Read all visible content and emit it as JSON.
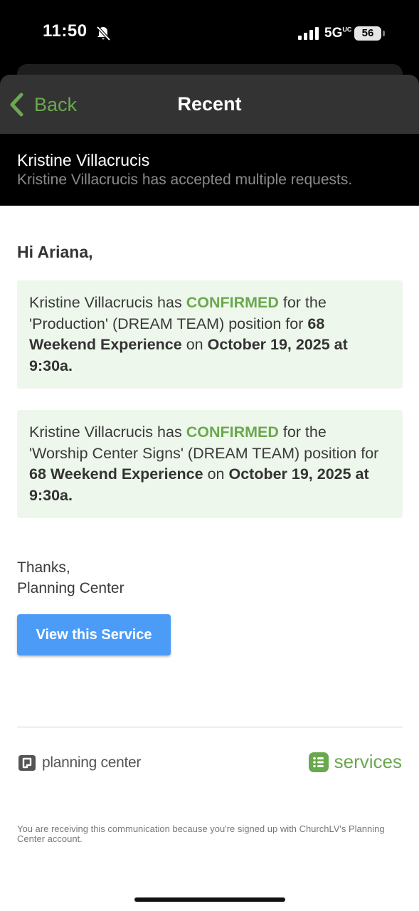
{
  "status_bar": {
    "time": "11:50",
    "network": "5G",
    "network_superscript": "UC",
    "battery": "56"
  },
  "nav": {
    "back_label": "Back",
    "title": "Recent"
  },
  "sender": {
    "name": "Kristine Villacrucis",
    "summary": "Kristine Villacrucis has accepted multiple requests."
  },
  "email": {
    "greeting": "Hi Ariana,",
    "notices": [
      {
        "person": "Kristine Villacrucis",
        "pre": " has ",
        "status": "CONFIRMED",
        "mid": " for the 'Production' (DREAM TEAM) position for ",
        "event": "68 Weekend Experience",
        "on": " on ",
        "datetime": "October 19, 2025 at 9:30a."
      },
      {
        "person": "Kristine Villacrucis",
        "pre": " has ",
        "status": "CONFIRMED",
        "mid": " for the 'Worship Center Signs' (DREAM TEAM) position for ",
        "event": "68 Weekend Experience",
        "on": " on ",
        "datetime": "October 19, 2025 at 9:30a."
      }
    ],
    "thanks": "Thanks,",
    "signature": "Planning Center",
    "view_button": "View this Service",
    "footer_brand": "planning center",
    "footer_product": "services",
    "footer_note": "You are receiving this communication because you're signed up with ChurchLV's Planning Center account."
  },
  "colors": {
    "accent_green": "#6aa84f",
    "button_blue": "#4c9cf7",
    "notice_bg": "#eef7ec"
  },
  "icons": [
    "bell-slash-icon",
    "signal-icon",
    "battery-icon",
    "chevron-left-icon",
    "planning-center-logo-icon",
    "services-logo-icon"
  ]
}
